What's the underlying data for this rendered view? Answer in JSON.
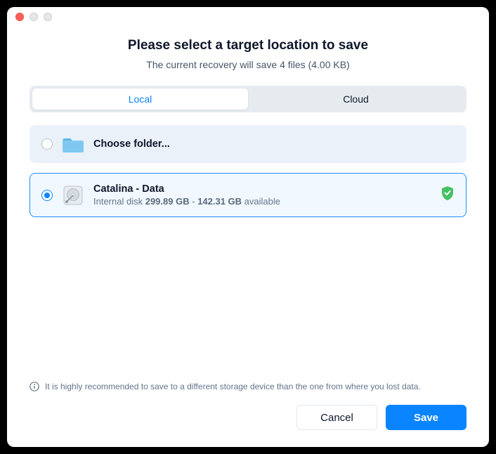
{
  "header": {
    "title": "Please select a target location to save",
    "subtitle": "The current recovery will save 4 files (4.00 KB)"
  },
  "tabs": {
    "local": "Local",
    "cloud": "Cloud"
  },
  "options": {
    "folder": {
      "label": "Choose folder..."
    },
    "disk": {
      "name": "Catalina - Data",
      "type": "Internal disk",
      "total": "299.89 GB",
      "separator": " - ",
      "available": "142.31 GB",
      "available_suffix": " available"
    }
  },
  "hint": "It is highly recommended to save to a different storage device than the one from where you lost data.",
  "footer": {
    "cancel": "Cancel",
    "save": "Save"
  }
}
